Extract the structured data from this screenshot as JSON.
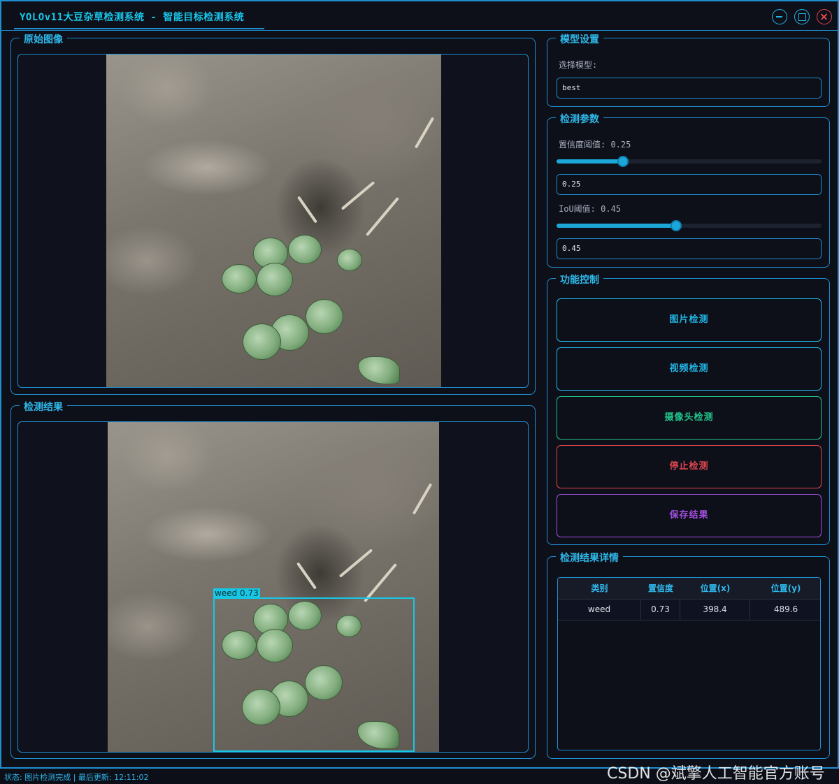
{
  "window": {
    "title": "YOLOv11大豆杂草检测系统 - 智能目标检测系统"
  },
  "panels": {
    "original": {
      "title": "原始图像"
    },
    "result": {
      "title": "检测结果",
      "detection_label": "weed 0.73"
    }
  },
  "model_settings": {
    "title": "模型设置",
    "select_label": "选择模型:",
    "model_value": "best"
  },
  "detection_params": {
    "title": "检测参数",
    "confidence": {
      "label": "置信度阈值: 0.25",
      "value": 0.25,
      "input_value": "0.25"
    },
    "iou": {
      "label": "IoU阈值: 0.45",
      "value": 0.45,
      "input_value": "0.45"
    }
  },
  "controls": {
    "title": "功能控制",
    "buttons": [
      {
        "label": "图片检测",
        "color": "#22b6e6"
      },
      {
        "label": "视频检测",
        "color": "#22b6e6"
      },
      {
        "label": "摄像头检测",
        "color": "#22c48a"
      },
      {
        "label": "停止检测",
        "color": "#e0474f"
      },
      {
        "label": "保存结果",
        "color": "#a44fe0"
      }
    ]
  },
  "results_table": {
    "title": "检测结果详情",
    "headers": [
      "类别",
      "置信度",
      "位置(x)",
      "位置(y)"
    ],
    "rows": [
      [
        "weed",
        "0.73",
        "398.4",
        "489.6"
      ]
    ]
  },
  "status_bar": {
    "text": "状态: 图片检测完成 | 最后更新: 12:11:02"
  },
  "watermark": {
    "text": "CSDN @斌擎人工智能官方账号"
  },
  "icons": {
    "minimize": "minimize-icon",
    "maximize": "maximize-icon",
    "close": "close-icon"
  },
  "colors": {
    "accent": "#1f8fd0",
    "title": "#18c7ea",
    "bbox": "#16c7e6"
  }
}
